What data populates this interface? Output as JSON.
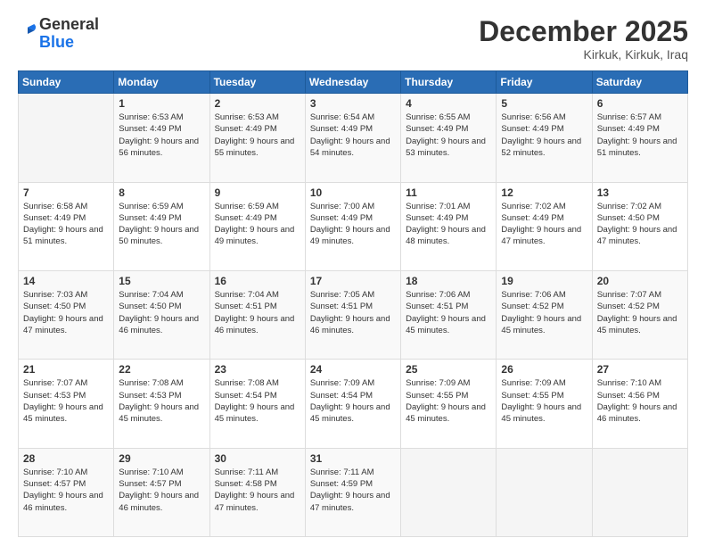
{
  "header": {
    "logo_general": "General",
    "logo_blue": "Blue",
    "month_title": "December 2025",
    "location": "Kirkuk, Kirkuk, Iraq"
  },
  "days_of_week": [
    "Sunday",
    "Monday",
    "Tuesday",
    "Wednesday",
    "Thursday",
    "Friday",
    "Saturday"
  ],
  "weeks": [
    [
      {
        "day": "",
        "sunrise": "",
        "sunset": "",
        "daylight": ""
      },
      {
        "day": "1",
        "sunrise": "Sunrise: 6:53 AM",
        "sunset": "Sunset: 4:49 PM",
        "daylight": "Daylight: 9 hours and 56 minutes."
      },
      {
        "day": "2",
        "sunrise": "Sunrise: 6:53 AM",
        "sunset": "Sunset: 4:49 PM",
        "daylight": "Daylight: 9 hours and 55 minutes."
      },
      {
        "day": "3",
        "sunrise": "Sunrise: 6:54 AM",
        "sunset": "Sunset: 4:49 PM",
        "daylight": "Daylight: 9 hours and 54 minutes."
      },
      {
        "day": "4",
        "sunrise": "Sunrise: 6:55 AM",
        "sunset": "Sunset: 4:49 PM",
        "daylight": "Daylight: 9 hours and 53 minutes."
      },
      {
        "day": "5",
        "sunrise": "Sunrise: 6:56 AM",
        "sunset": "Sunset: 4:49 PM",
        "daylight": "Daylight: 9 hours and 52 minutes."
      },
      {
        "day": "6",
        "sunrise": "Sunrise: 6:57 AM",
        "sunset": "Sunset: 4:49 PM",
        "daylight": "Daylight: 9 hours and 51 minutes."
      }
    ],
    [
      {
        "day": "7",
        "sunrise": "Sunrise: 6:58 AM",
        "sunset": "Sunset: 4:49 PM",
        "daylight": "Daylight: 9 hours and 51 minutes."
      },
      {
        "day": "8",
        "sunrise": "Sunrise: 6:59 AM",
        "sunset": "Sunset: 4:49 PM",
        "daylight": "Daylight: 9 hours and 50 minutes."
      },
      {
        "day": "9",
        "sunrise": "Sunrise: 6:59 AM",
        "sunset": "Sunset: 4:49 PM",
        "daylight": "Daylight: 9 hours and 49 minutes."
      },
      {
        "day": "10",
        "sunrise": "Sunrise: 7:00 AM",
        "sunset": "Sunset: 4:49 PM",
        "daylight": "Daylight: 9 hours and 49 minutes."
      },
      {
        "day": "11",
        "sunrise": "Sunrise: 7:01 AM",
        "sunset": "Sunset: 4:49 PM",
        "daylight": "Daylight: 9 hours and 48 minutes."
      },
      {
        "day": "12",
        "sunrise": "Sunrise: 7:02 AM",
        "sunset": "Sunset: 4:49 PM",
        "daylight": "Daylight: 9 hours and 47 minutes."
      },
      {
        "day": "13",
        "sunrise": "Sunrise: 7:02 AM",
        "sunset": "Sunset: 4:50 PM",
        "daylight": "Daylight: 9 hours and 47 minutes."
      }
    ],
    [
      {
        "day": "14",
        "sunrise": "Sunrise: 7:03 AM",
        "sunset": "Sunset: 4:50 PM",
        "daylight": "Daylight: 9 hours and 47 minutes."
      },
      {
        "day": "15",
        "sunrise": "Sunrise: 7:04 AM",
        "sunset": "Sunset: 4:50 PM",
        "daylight": "Daylight: 9 hours and 46 minutes."
      },
      {
        "day": "16",
        "sunrise": "Sunrise: 7:04 AM",
        "sunset": "Sunset: 4:51 PM",
        "daylight": "Daylight: 9 hours and 46 minutes."
      },
      {
        "day": "17",
        "sunrise": "Sunrise: 7:05 AM",
        "sunset": "Sunset: 4:51 PM",
        "daylight": "Daylight: 9 hours and 46 minutes."
      },
      {
        "day": "18",
        "sunrise": "Sunrise: 7:06 AM",
        "sunset": "Sunset: 4:51 PM",
        "daylight": "Daylight: 9 hours and 45 minutes."
      },
      {
        "day": "19",
        "sunrise": "Sunrise: 7:06 AM",
        "sunset": "Sunset: 4:52 PM",
        "daylight": "Daylight: 9 hours and 45 minutes."
      },
      {
        "day": "20",
        "sunrise": "Sunrise: 7:07 AM",
        "sunset": "Sunset: 4:52 PM",
        "daylight": "Daylight: 9 hours and 45 minutes."
      }
    ],
    [
      {
        "day": "21",
        "sunrise": "Sunrise: 7:07 AM",
        "sunset": "Sunset: 4:53 PM",
        "daylight": "Daylight: 9 hours and 45 minutes."
      },
      {
        "day": "22",
        "sunrise": "Sunrise: 7:08 AM",
        "sunset": "Sunset: 4:53 PM",
        "daylight": "Daylight: 9 hours and 45 minutes."
      },
      {
        "day": "23",
        "sunrise": "Sunrise: 7:08 AM",
        "sunset": "Sunset: 4:54 PM",
        "daylight": "Daylight: 9 hours and 45 minutes."
      },
      {
        "day": "24",
        "sunrise": "Sunrise: 7:09 AM",
        "sunset": "Sunset: 4:54 PM",
        "daylight": "Daylight: 9 hours and 45 minutes."
      },
      {
        "day": "25",
        "sunrise": "Sunrise: 7:09 AM",
        "sunset": "Sunset: 4:55 PM",
        "daylight": "Daylight: 9 hours and 45 minutes."
      },
      {
        "day": "26",
        "sunrise": "Sunrise: 7:09 AM",
        "sunset": "Sunset: 4:55 PM",
        "daylight": "Daylight: 9 hours and 45 minutes."
      },
      {
        "day": "27",
        "sunrise": "Sunrise: 7:10 AM",
        "sunset": "Sunset: 4:56 PM",
        "daylight": "Daylight: 9 hours and 46 minutes."
      }
    ],
    [
      {
        "day": "28",
        "sunrise": "Sunrise: 7:10 AM",
        "sunset": "Sunset: 4:57 PM",
        "daylight": "Daylight: 9 hours and 46 minutes."
      },
      {
        "day": "29",
        "sunrise": "Sunrise: 7:10 AM",
        "sunset": "Sunset: 4:57 PM",
        "daylight": "Daylight: 9 hours and 46 minutes."
      },
      {
        "day": "30",
        "sunrise": "Sunrise: 7:11 AM",
        "sunset": "Sunset: 4:58 PM",
        "daylight": "Daylight: 9 hours and 47 minutes."
      },
      {
        "day": "31",
        "sunrise": "Sunrise: 7:11 AM",
        "sunset": "Sunset: 4:59 PM",
        "daylight": "Daylight: 9 hours and 47 minutes."
      },
      {
        "day": "",
        "sunrise": "",
        "sunset": "",
        "daylight": ""
      },
      {
        "day": "",
        "sunrise": "",
        "sunset": "",
        "daylight": ""
      },
      {
        "day": "",
        "sunrise": "",
        "sunset": "",
        "daylight": ""
      }
    ]
  ]
}
